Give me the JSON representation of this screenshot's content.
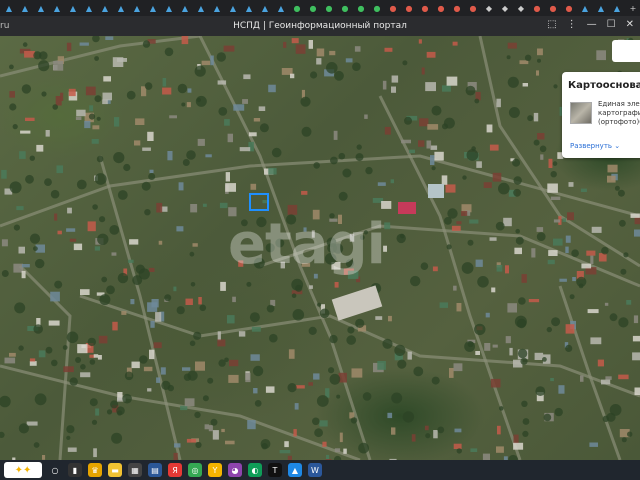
{
  "browser": {
    "tabs": [
      {
        "color": "#4aa3df",
        "glyph": "▲"
      },
      {
        "color": "#4aa3df",
        "glyph": "▲"
      },
      {
        "color": "#4aa3df",
        "glyph": "▲"
      },
      {
        "color": "#4aa3df",
        "glyph": "▲"
      },
      {
        "color": "#4aa3df",
        "glyph": "▲"
      },
      {
        "color": "#4aa3df",
        "glyph": "▲"
      },
      {
        "color": "#4aa3df",
        "glyph": "▲"
      },
      {
        "color": "#4aa3df",
        "glyph": "▲"
      },
      {
        "color": "#4aa3df",
        "glyph": "▲"
      },
      {
        "color": "#4aa3df",
        "glyph": "▲"
      },
      {
        "color": "#4aa3df",
        "glyph": "▲"
      },
      {
        "color": "#4aa3df",
        "glyph": "▲"
      },
      {
        "color": "#4aa3df",
        "glyph": "▲"
      },
      {
        "color": "#4aa3df",
        "glyph": "▲"
      },
      {
        "color": "#4aa3df",
        "glyph": "▲"
      },
      {
        "color": "#4aa3df",
        "glyph": "▲"
      },
      {
        "color": "#4aa3df",
        "glyph": "▲"
      },
      {
        "color": "#4aa3df",
        "glyph": "▲"
      },
      {
        "color": "#3fbf5f",
        "glyph": "●"
      },
      {
        "color": "#3fbf5f",
        "glyph": "●"
      },
      {
        "color": "#3fbf5f",
        "glyph": "●"
      },
      {
        "color": "#3fbf5f",
        "glyph": "●"
      },
      {
        "color": "#3fbf5f",
        "glyph": "●"
      },
      {
        "color": "#3fbf5f",
        "glyph": "●"
      },
      {
        "color": "#e05a4a",
        "glyph": "●"
      },
      {
        "color": "#e05a4a",
        "glyph": "●"
      },
      {
        "color": "#e05a4a",
        "glyph": "●"
      },
      {
        "color": "#e05a4a",
        "glyph": "●"
      },
      {
        "color": "#e05a4a",
        "glyph": "●"
      },
      {
        "color": "#e05a4a",
        "glyph": "●"
      },
      {
        "color": "#cccccc",
        "glyph": "◆"
      },
      {
        "color": "#cccccc",
        "glyph": "◆"
      },
      {
        "color": "#cccccc",
        "glyph": "◆"
      },
      {
        "color": "#e05a4a",
        "glyph": "●"
      },
      {
        "color": "#e05a4a",
        "glyph": "●"
      },
      {
        "color": "#e05a4a",
        "glyph": "●"
      },
      {
        "color": "#4aa3df",
        "glyph": "▲"
      },
      {
        "color": "#4aa3df",
        "glyph": "▲"
      },
      {
        "color": "#4aa3df",
        "glyph": "▲"
      }
    ],
    "new_tab": "+",
    "overflow": "✕",
    "url_fragment": "ru",
    "title": "НСПД | Геоинформационный портал",
    "window_controls": {
      "minimize": "—",
      "maximize": "☐",
      "close": "✕"
    },
    "menu": "⋮",
    "extensions": "⬚"
  },
  "map": {
    "watermark": "etagi",
    "highlight_color": "#1f8fff"
  },
  "panel": {
    "title": "Картооснова",
    "description_lines": [
      "Единая элек",
      "картографи",
      "(ортофото)("
    ],
    "expand_link": "Развернуть",
    "expand_chevron": "⌄"
  },
  "taskbar": {
    "start_glyph": "✦✦",
    "icons": [
      {
        "name": "search-icon",
        "glyph": "○",
        "color": "transparent"
      },
      {
        "name": "task-view-icon",
        "glyph": "▮",
        "color": "#333"
      },
      {
        "name": "app-icon-1",
        "glyph": "♛",
        "color": "#e6a400"
      },
      {
        "name": "file-explorer-icon",
        "glyph": "▬",
        "color": "#f1c232"
      },
      {
        "name": "app-icon-2",
        "glyph": "▦",
        "color": "#444"
      },
      {
        "name": "app-icon-3",
        "glyph": "▤",
        "color": "#2b5797"
      },
      {
        "name": "yandex-icon",
        "glyph": "Я",
        "color": "#e53935"
      },
      {
        "name": "chrome-icon",
        "glyph": "◎",
        "color": "#34a853"
      },
      {
        "name": "yandex-browser-icon",
        "glyph": "Y",
        "color": "#f4b400"
      },
      {
        "name": "app-icon-4",
        "glyph": "◕",
        "color": "#8e44ad"
      },
      {
        "name": "edge-icon",
        "glyph": "◐",
        "color": "#0f9d58"
      },
      {
        "name": "tradingview-icon",
        "glyph": "T",
        "color": "#111"
      },
      {
        "name": "app-icon-5",
        "glyph": "▲",
        "color": "#1e88e5"
      },
      {
        "name": "word-icon",
        "glyph": "W",
        "color": "#2b579a"
      }
    ]
  }
}
